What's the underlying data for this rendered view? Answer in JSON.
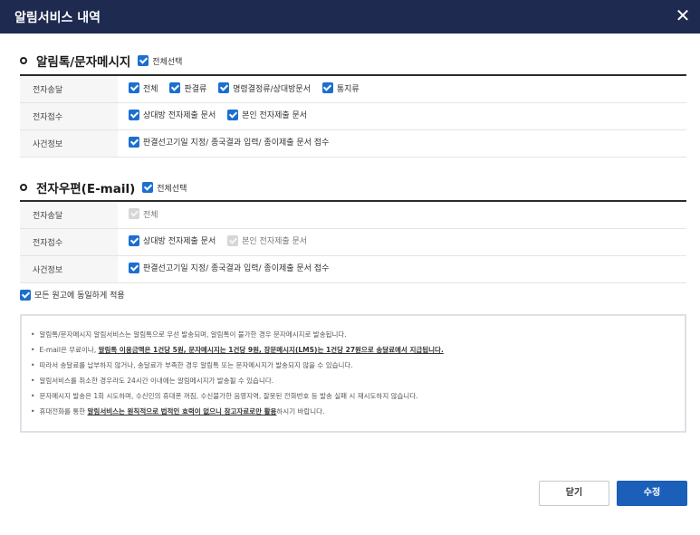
{
  "dialog": {
    "title": "알림서비스 내역",
    "close_icon": "✕"
  },
  "kakao": {
    "title": "알림톡/문자메시지",
    "select_all": "전체선택",
    "rows": [
      {
        "label": "전자송달",
        "items": [
          {
            "text": "전체",
            "checked": true
          },
          {
            "text": "판결류",
            "checked": true
          },
          {
            "text": "명령결정류/상대방문서",
            "checked": true
          },
          {
            "text": "통지류",
            "checked": true
          }
        ]
      },
      {
        "label": "전자접수",
        "items": [
          {
            "text": "상대방 전자제출 문서",
            "checked": true
          },
          {
            "text": "본인 전자제출 문서",
            "checked": true
          }
        ]
      },
      {
        "label": "사건정보",
        "items": [
          {
            "text": "판결선고기일 지정/ 종국결과 입력/ 종이제출 문서 접수",
            "checked": true
          }
        ]
      }
    ]
  },
  "email": {
    "title": "전자우편(E-mail)",
    "select_all": "전체선택",
    "rows": [
      {
        "label": "전자송달",
        "items": [
          {
            "text": "전체",
            "checked": false
          }
        ]
      },
      {
        "label": "전자접수",
        "items": [
          {
            "text": "상대방 전자제출 문서",
            "checked": true
          },
          {
            "text": "본인 전자제출 문서",
            "checked": false
          }
        ]
      },
      {
        "label": "사건정보",
        "items": [
          {
            "text": "판결선고기일 지정/ 종국결과 입력/ 종이제출 문서 접수",
            "checked": true
          }
        ]
      }
    ]
  },
  "apply_all": "모든 원고에 동일하게 적용",
  "notice": {
    "line1": "알림톡/문자메시지 알림서비스는 알림톡으로 우선 발송되며, 알림톡이 불가한 경우 문자메시지로 발송됩니다.",
    "line2_a": "E-mail은 무료이나, ",
    "line2_b": "알림톡 이용금액은 1건당 5원, 문자메시지는 1건당 9원, 장문메시지(LMS)는 1건당 27원으로 송달료에서 지급됩니다.",
    "line3": "따라서 송달료를 납부하지 않거나, 송달료가 부족한 경우 알림톡 또는 문자메시지가 발송되지 않을 수 있습니다.",
    "line4": "알림서비스를 취소한 경우라도 24시간 이내에는 알림메시지가 발송될 수 있습니다.",
    "line5": "문자메시지 발송은 1회 시도하며, 수신인의 휴대폰 꺼짐, 수신불가한 음영지역, 잘못된 전화번호 등 발송 실패 시 재시도하지 않습니다.",
    "line6_a": "휴대전화를 통한 ",
    "line6_b": "알림서비스는 원칙적으로 법적인 효력이 없으니 참고자료로만 활용",
    "line6_c": "하시기 바랍니다."
  },
  "buttons": {
    "close": "닫기",
    "edit": "수정"
  },
  "colors": {
    "header": "#1e2a4f",
    "accent": "#1b6fd1",
    "primary_button": "#1b5fb8"
  }
}
